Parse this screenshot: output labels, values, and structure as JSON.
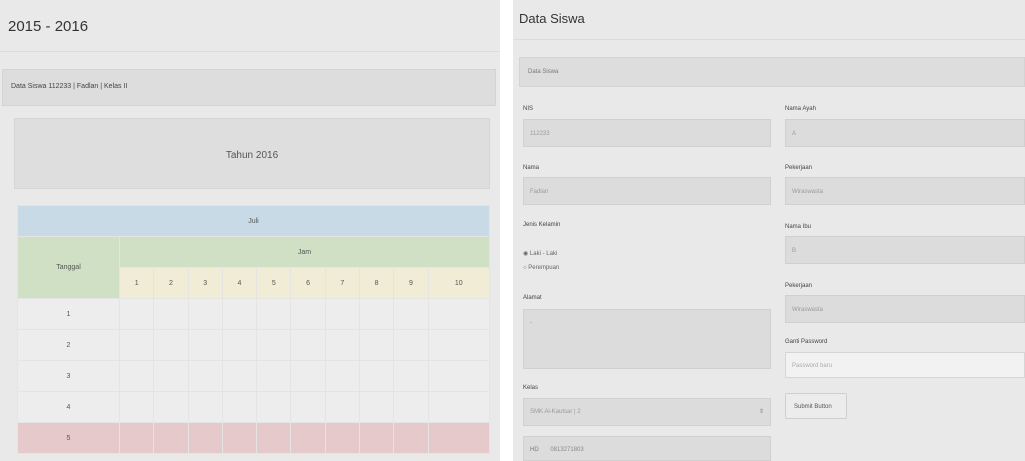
{
  "left": {
    "title": "2015 - 2016",
    "breadcrumb": "Data Siswa 112233 | Fadlan | Kelas II",
    "year_label": "Tahun 2016",
    "table": {
      "month": "Juli",
      "tanggal_label": "Tanggal",
      "jam_label": "Jam",
      "jam_cols": [
        "1",
        "2",
        "3",
        "4",
        "5",
        "6",
        "7",
        "8",
        "9",
        "10"
      ],
      "rows": [
        "1",
        "2",
        "3",
        "4",
        "5"
      ]
    }
  },
  "right": {
    "title": "Data Siswa",
    "crumb": "Data Siswa",
    "nis_label": "NIS",
    "nis_value": "112233",
    "nama_label": "Nama",
    "nama_value": "Fadlan",
    "jk_label": "Jenis Kelamin",
    "jk_options": [
      "Laki - Laki",
      "Perempuan"
    ],
    "alamat_label": "Alamat",
    "alamat_value": "-",
    "kelas_label": "Kelas",
    "kelas_value": "SMK Al-Kautsar | 2",
    "hp_tag": "HD",
    "hp_value": "0813271803",
    "ayah_label": "Nama Ayah",
    "ayah_value": "A",
    "pek1_label": "Pekerjaan",
    "pek1_value": "Wiraswasta",
    "ibu_label": "Nama Ibu",
    "ibu_value": "B",
    "pek2_label": "Pekerjaan",
    "pek2_value": "Wiraswasta",
    "pw_label": "Ganti Password",
    "pw_placeholder": "Password baru",
    "submit_label": "Submit Button"
  }
}
